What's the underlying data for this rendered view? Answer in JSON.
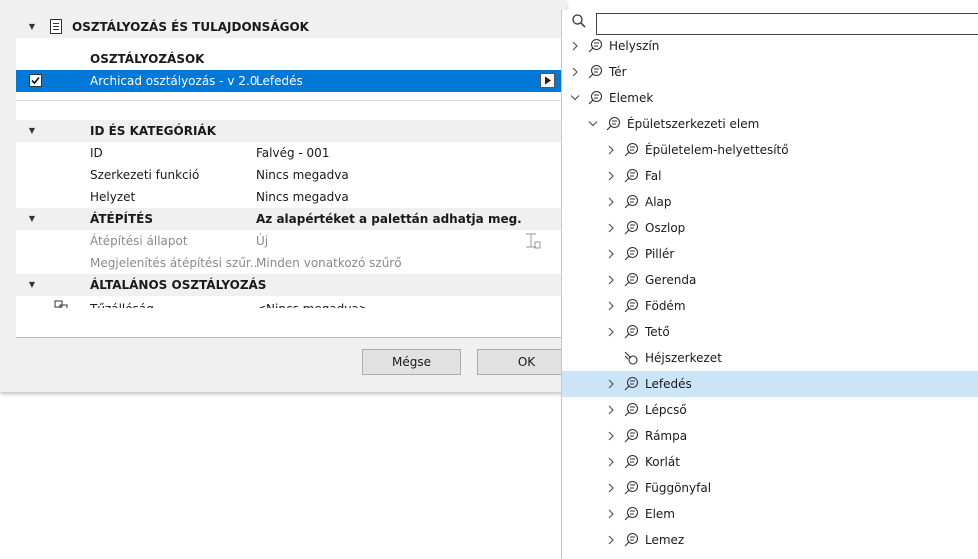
{
  "settings": {
    "header_title": "OSZTÁLYOZÁS ÉS TULAJDONSÁGOK",
    "classifications": {
      "title": "OSZTÁLYOZÁSOK",
      "system": "Archicad osztályozás - v 2.0",
      "value": "Lefedés"
    },
    "id_category": {
      "title": "ID ÉS KATEGÓRIÁK",
      "rows": [
        {
          "label": "ID",
          "value": "Falvég - 001"
        },
        {
          "label": "Szerkezeti funkció",
          "value": "Nincs megadva"
        },
        {
          "label": "Helyzet",
          "value": "Nincs megadva"
        }
      ]
    },
    "renovation": {
      "title": "ÁTÉPÍTÉS",
      "note": "Az alapértéket a palettán adhatja meg.",
      "rows": [
        {
          "label": "Átépítési állapot",
          "value": "Új"
        },
        {
          "label": "Megjelenítés átépítési szűr...",
          "value": "Minden vonatkozó szűrő"
        }
      ]
    },
    "general": {
      "title": "ÁLTALÁNOS OSZTÁLYOZÁS",
      "rows": [
        {
          "label": "Tűzállóság",
          "value": "<Nincs megadva>"
        }
      ]
    },
    "buttons": {
      "cancel": "Mégse",
      "ok": "OK"
    }
  },
  "tree": {
    "search_placeholder": "",
    "items": [
      {
        "label": "Helyszín",
        "expanded": false
      },
      {
        "label": "Tér",
        "expanded": false
      },
      {
        "label": "Elemek",
        "expanded": true
      },
      {
        "label": "Épületszerkezeti elem",
        "expanded": true
      },
      {
        "label": "Épületelem-helyettesítő",
        "expanded": false
      },
      {
        "label": "Fal",
        "expanded": false
      },
      {
        "label": "Alap",
        "expanded": false
      },
      {
        "label": "Oszlop",
        "expanded": false
      },
      {
        "label": "Pillér",
        "expanded": false
      },
      {
        "label": "Gerenda",
        "expanded": false
      },
      {
        "label": "Födém",
        "expanded": false
      },
      {
        "label": "Tető",
        "expanded": false
      },
      {
        "label": "Héjszerkezet",
        "expanded": null
      },
      {
        "label": "Lefedés",
        "expanded": false,
        "selected": true
      },
      {
        "label": "Lépcső",
        "expanded": false
      },
      {
        "label": "Rámpa",
        "expanded": false
      },
      {
        "label": "Korlát",
        "expanded": false
      },
      {
        "label": "Függönyfal",
        "expanded": false
      },
      {
        "label": "Elem",
        "expanded": false
      },
      {
        "label": "Lemez",
        "expanded": false
      }
    ]
  },
  "colors": {
    "selection": "#0078d7",
    "tree_highlight": "#cce4f7",
    "section_bg": "#f0f0f0"
  }
}
